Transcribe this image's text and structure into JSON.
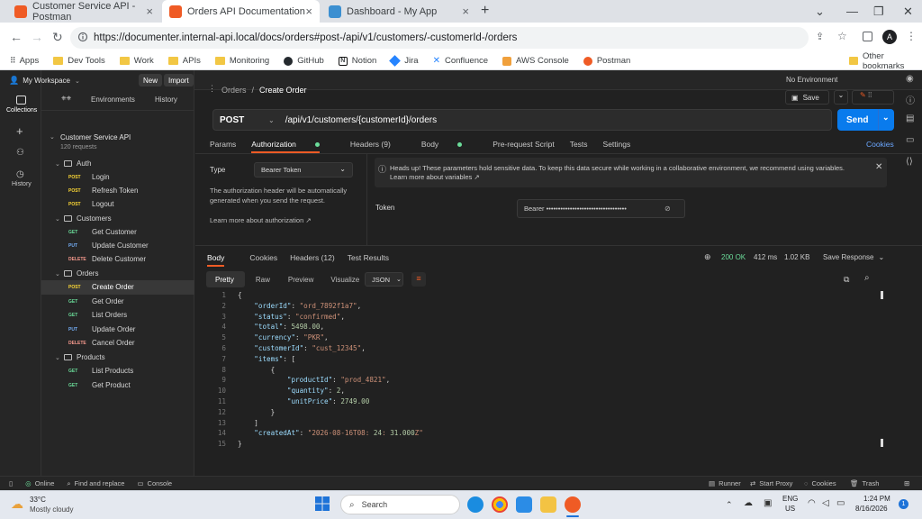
{
  "browser": {
    "tabs": [
      {
        "title": "Customer Service API - Postman",
        "active": false,
        "icon_color": "#ef5b25"
      },
      {
        "title": "Orders API Documentation",
        "active": true,
        "icon_color": "#ef5b25"
      },
      {
        "title": "Dashboard - My App",
        "active": false,
        "icon_color": "#3b8fd1"
      }
    ],
    "url": "https://documenter.internal-api.local/docs/orders#post-/api/v1/customers/-customerId-/orders",
    "profile_initial": "A",
    "bookmarks": [
      "Apps",
      "Dev Tools",
      "Work",
      "APIs",
      "Monitoring",
      "GitHub",
      "Notion",
      "Jira",
      "Confluence",
      "AWS Console",
      "Postman"
    ],
    "other_bookmarks": "Other bookmarks"
  },
  "postman": {
    "workspace": "My Workspace",
    "new_label": "New",
    "import_label": "Import",
    "rail": {
      "collections": "Collections",
      "history": "History"
    },
    "sidebar_tabs": {
      "environments": "Environments",
      "history": "History"
    },
    "environment": "No Environment",
    "collection": {
      "name": "Customer Service API",
      "count": "120 requests",
      "folders": [
        {
          "name": "Auth",
          "requests": [
            {
              "method": "POST",
              "name": "Login"
            },
            {
              "method": "POST",
              "name": "Refresh Token"
            },
            {
              "method": "POST",
              "name": "Logout"
            }
          ]
        },
        {
          "name": "Customers",
          "requests": [
            {
              "method": "GET",
              "name": "Get Customer"
            },
            {
              "method": "PUT",
              "name": "Update Customer"
            },
            {
              "method": "DELETE",
              "name": "Delete Customer"
            }
          ]
        },
        {
          "name": "Orders",
          "requests": [
            {
              "method": "POST",
              "name": "Create Order"
            },
            {
              "method": "GET",
              "name": "Get Order"
            },
            {
              "method": "GET",
              "name": "List Orders"
            },
            {
              "method": "PUT",
              "name": "Update Order"
            },
            {
              "method": "DELETE",
              "name": "Cancel Order"
            }
          ]
        },
        {
          "name": "Products",
          "requests": [
            {
              "method": "GET",
              "name": "List Products"
            },
            {
              "method": "GET",
              "name": "Get Product"
            }
          ]
        }
      ]
    },
    "breadcrumb": {
      "parent": "Orders",
      "separator": "/",
      "current": "Create Order"
    },
    "save_label": "Save",
    "request": {
      "method": "POST",
      "url": "/api/v1/customers/{customerId}/orders",
      "send_label": "Send"
    },
    "request_tabs": [
      "Params",
      "Authorization",
      "Headers (9)",
      "Body",
      "Pre-request Script",
      "Tests",
      "Settings"
    ],
    "cookies_label": "Cookies",
    "auth": {
      "type_label": "Type",
      "type_value": "Bearer Token",
      "description": "The authorization header will be automatically generated when you send the request.",
      "learn_more": "Learn more about authorization ↗",
      "notice": "Heads up! These parameters hold sensitive data. To keep this data secure while working in a collaborative environment, we recommend using variables.",
      "notice_link": "Learn more about variables ↗",
      "token_label": "Token",
      "token_value": "Bearer ••••••••••••••••••••••••••••••••••"
    },
    "response": {
      "tabs": [
        "Body",
        "Cookies",
        "Headers (12)",
        "Test Results"
      ],
      "status": "200 OK",
      "time": "412 ms",
      "size": "1.02 KB",
      "save_response": "Save Response",
      "view_tabs": [
        "Pretty",
        "Raw",
        "Preview",
        "Visualize"
      ],
      "format": "JSON",
      "lines": [
        "{",
        "    \"orderId\": \"ord_7892f1a7\",",
        "    \"status\": \"confirmed\",",
        "    \"total\": 5498.00,",
        "    \"currency\": \"PKR\",",
        "    \"customerId\": \"cust_12345\",",
        "    \"items\": [",
        "        {",
        "            \"productId\": \"prod_4821\",",
        "            \"quantity\": 2,",
        "            \"unitPrice\": 2749.00",
        "        }",
        "    ]",
        "    \"createdAt\": \"2026-08-16T08:24:31.000Z\"",
        "}"
      ]
    },
    "statusbar": {
      "online": "Online",
      "find_replace": "Find and replace",
      "console": "Console",
      "runner": "Runner",
      "start_proxy": "Start Proxy",
      "cookies": "Cookies",
      "trash": "Trash"
    }
  },
  "taskbar": {
    "weather_temp": "33°C",
    "weather_desc": "Mostly cloudy",
    "search_placeholder": "Search",
    "lang_top": "ENG",
    "lang_bottom": "US",
    "time": "1:24 PM",
    "date": "8/16/2026"
  }
}
